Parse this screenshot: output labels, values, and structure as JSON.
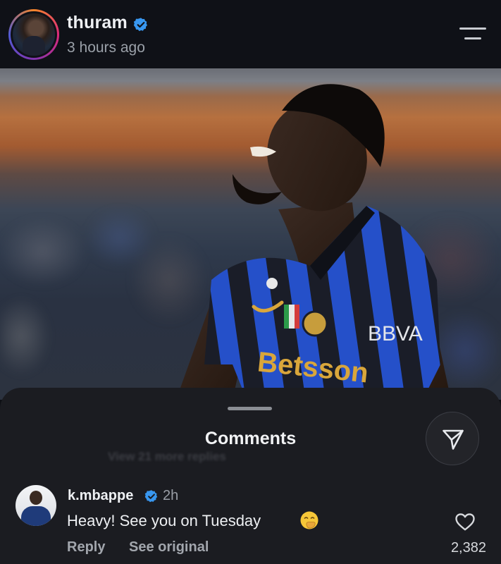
{
  "post": {
    "username": "thuram",
    "verified": true,
    "time_ago": "3 hours ago",
    "photo_icon": "post-photo",
    "shirt_sponsor": "Betsson",
    "sleeve_sponsor": "BBVA"
  },
  "header": {
    "menu_icon": "hamburger-menu-icon"
  },
  "comments_sheet": {
    "title": "Comments",
    "share_icon": "send-paper-plane-icon",
    "background_hint": "View 21 more replies",
    "comments": [
      {
        "username": "k.mbappe",
        "verified": true,
        "time": "2h",
        "text": "Heavy! See you on Tuesday",
        "emoji": "face-with-hand-over-mouth",
        "reply_label": "Reply",
        "see_original_label": "See original",
        "likes": "2,382",
        "like_icon": "heart-outline-icon"
      }
    ]
  },
  "colors": {
    "background": "#0f1117",
    "sheet": "#1b1c21",
    "verified_blue": "#3897f0",
    "inter_blue": "#1f4fd1",
    "text_primary": "#eef0f3",
    "text_secondary": "#9aa0a8"
  }
}
